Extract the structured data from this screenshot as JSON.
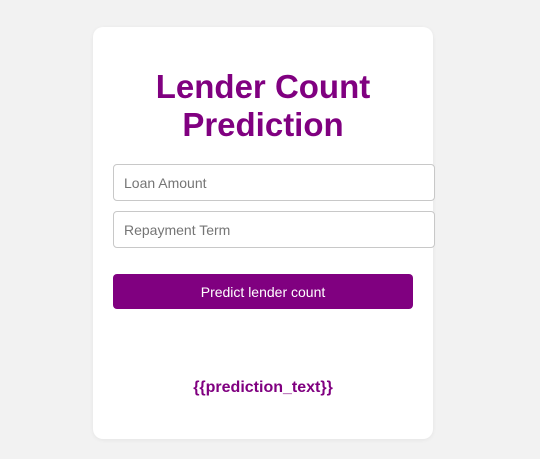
{
  "form": {
    "title": "Lender Count Prediction",
    "loan_amount_placeholder": "Loan Amount",
    "loan_amount_value": "",
    "repayment_term_placeholder": "Repayment Term",
    "repayment_term_value": "",
    "submit_label": "Predict lender count"
  },
  "result": {
    "text": "{{prediction_text}}"
  },
  "colors": {
    "accent": "#800080",
    "background": "#f2f2f2",
    "card": "#ffffff"
  }
}
